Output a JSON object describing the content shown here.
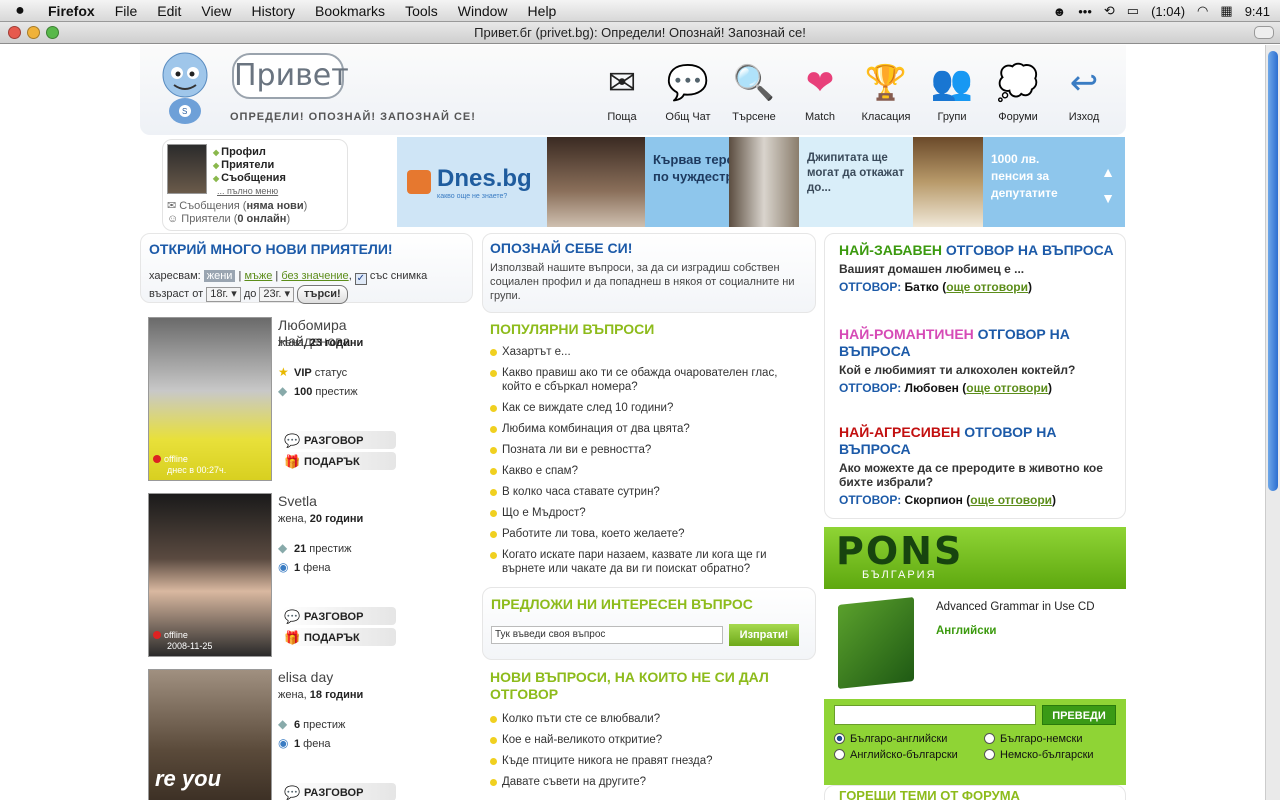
{
  "menubar": {
    "app": "Firefox",
    "items": [
      "File",
      "Edit",
      "View",
      "History",
      "Bookmarks",
      "Tools",
      "Window",
      "Help"
    ],
    "battery": "(1:04)",
    "clock": "9:41"
  },
  "window": {
    "title": "Привет.бг (privet.bg): Определи! Опознай! Запознай се!"
  },
  "header": {
    "logo": "Привет",
    "slogan": "ОПРЕДЕЛИ! ОПОЗНАЙ! ЗАПОЗНАЙ СЕ!",
    "nav": [
      {
        "label": "Поща",
        "icon": "mail-icon",
        "glyph": "✉"
      },
      {
        "label": "Общ Чат",
        "icon": "chat-icon",
        "glyph": "💬"
      },
      {
        "label": "Търсене",
        "icon": "search-icon",
        "glyph": "🔍"
      },
      {
        "label": "Match",
        "icon": "heart-icon",
        "glyph": "❤"
      },
      {
        "label": "Класация",
        "icon": "trophy-icon",
        "glyph": "🏆"
      },
      {
        "label": "Групи",
        "icon": "group-icon",
        "glyph": "👥"
      },
      {
        "label": "Форуми",
        "icon": "forum-icon",
        "glyph": "💭"
      },
      {
        "label": "Изход",
        "icon": "logout-icon",
        "glyph": "↩"
      }
    ]
  },
  "userbox": {
    "menu": [
      "Профил",
      "Приятели",
      "Съобщения"
    ],
    "full_menu": "... пълно меню",
    "messages_label": "Съобщения (",
    "messages_value": "няма нови",
    "friends_label": "Приятели (",
    "friends_value": "0 онлайн",
    "close": ")"
  },
  "banner": {
    "brand": "Dnes.bg",
    "brand_sub": "какво още не знаете?",
    "story1": "Кървав терор по чуждестран",
    "story2": "Джипитата ще могат да откажат до...",
    "story3": "1000 лв. пенсия за депутатите"
  },
  "friends": {
    "title": "ОТКРИЙ МНОГО НОВИ ПРИЯТЕЛИ!",
    "like_label": "харесвам:",
    "opt_women": "жени",
    "opt_men": "мъже",
    "opt_any": "без значение",
    "with_photo": "със снимка",
    "age_from_label": "възраст от",
    "age_from": "18г.",
    "age_to_label": "до",
    "age_to": "23г.",
    "search": "търси!",
    "people": [
      {
        "name": "Любомира Найденова",
        "gender": "жена,",
        "age": "23 години",
        "stat1_val": "VIP",
        "stat1_txt": " статус",
        "stat2_val": "100",
        "stat2_txt": " престиж",
        "status": "offline",
        "when": "днес в 00:27ч.",
        "chat": "РАЗГОВОР",
        "gift": "ПОДАРЪК"
      },
      {
        "name": "Svetla",
        "gender": "жена,",
        "age": "20 години",
        "stat1_val": "21",
        "stat1_txt": " престиж",
        "stat2_val": "1",
        "stat2_txt": " фена",
        "status": "offline",
        "when": "2008-11-25",
        "chat": "РАЗГОВОР",
        "gift": "ПОДАРЪК"
      },
      {
        "name": "elisa day",
        "gender": "жена,",
        "age": "18 години",
        "stat1_val": "6",
        "stat1_txt": " престиж",
        "stat2_val": "1",
        "stat2_txt": " фена",
        "status": "",
        "when": "",
        "chat": "РАЗГОВОР",
        "gift": ""
      }
    ]
  },
  "about": {
    "title": "ОПОЗНАЙ СЕБЕ СИ!",
    "desc": "Използвай нашите въпроси, за да си изградиш собствен социален профил и да попаднеш в някоя от социалните ни групи.",
    "popular_title": "ПОПУЛЯРНИ ВЪПРОСИ",
    "popular": [
      "Хазартът е...",
      "Какво правиш ако ти се обажда очарователен глас, който е сбъркал номера?",
      "Как се виждате след 10 години?",
      "Любима комбинация от два цвята?",
      "Позната ли ви е ревността?",
      "Какво е спам?",
      "В колко часа ставате сутрин?",
      "Що е Мъдрост?",
      "Работите ли това, което желаете?",
      "Когато искате пари назаем, казвате ли кога ще ги върнете или чакате да ви ги поискат обратно?"
    ],
    "suggest_title": "ПРЕДЛОЖИ НИ ИНТЕРЕСЕН ВЪПРОС",
    "suggest_value": "Тук въведи своя въпрос",
    "send": "Изпрати!",
    "new_title": "НОВИ ВЪПРОСИ, НА КОИТО НЕ СИ ДАЛ ОТГОВОР",
    "new": [
      "Колко пъти сте се влюбвали?",
      "Кое е най-великото откритие?",
      "Къде птиците никога не правят гнезда?",
      "Давате съвети на другите?"
    ]
  },
  "answers": [
    {
      "kind": "НАЙ-ЗАБАВЕН",
      "rest": " ОТГОВОР НА ВЪПРОСА",
      "question": "Вашият домашен любимец е ...",
      "label": "ОТГОВОР:",
      "answer": " Батко (",
      "more": "още отговори",
      "close": ")"
    },
    {
      "kind": "НАЙ-РОМАНТИЧЕН",
      "rest": " ОТГОВОР НА ВЪПРОСА",
      "question": "Кой е любимият ти алкохолен коктейл?",
      "label": "ОТГОВОР:",
      "answer": " Любовен (",
      "more": "още отговори",
      "close": ")"
    },
    {
      "kind": "НАЙ-АГРЕСИВЕН",
      "rest": " ОТГОВОР НА ВЪПРОСА",
      "question": "Ако можехте да се преродите в животно кое бихте избрали?",
      "label": "ОТГОВОР:",
      "answer": " Скорпион (",
      "more": "още отговори",
      "close": ")"
    }
  ],
  "pons": {
    "brand": "PONS",
    "country": "БЪЛГАРИЯ",
    "book_title": "Advanced Grammar in Use CD",
    "book_lang": "Английски",
    "translate": "ПРЕВЕДИ",
    "options": [
      "Българо-английски",
      "Българо-немски",
      "Английско-български",
      "Немско-български"
    ]
  },
  "forum_stub": "ГОРЕЩИ ТЕМИ ОТ ФОРУМА"
}
